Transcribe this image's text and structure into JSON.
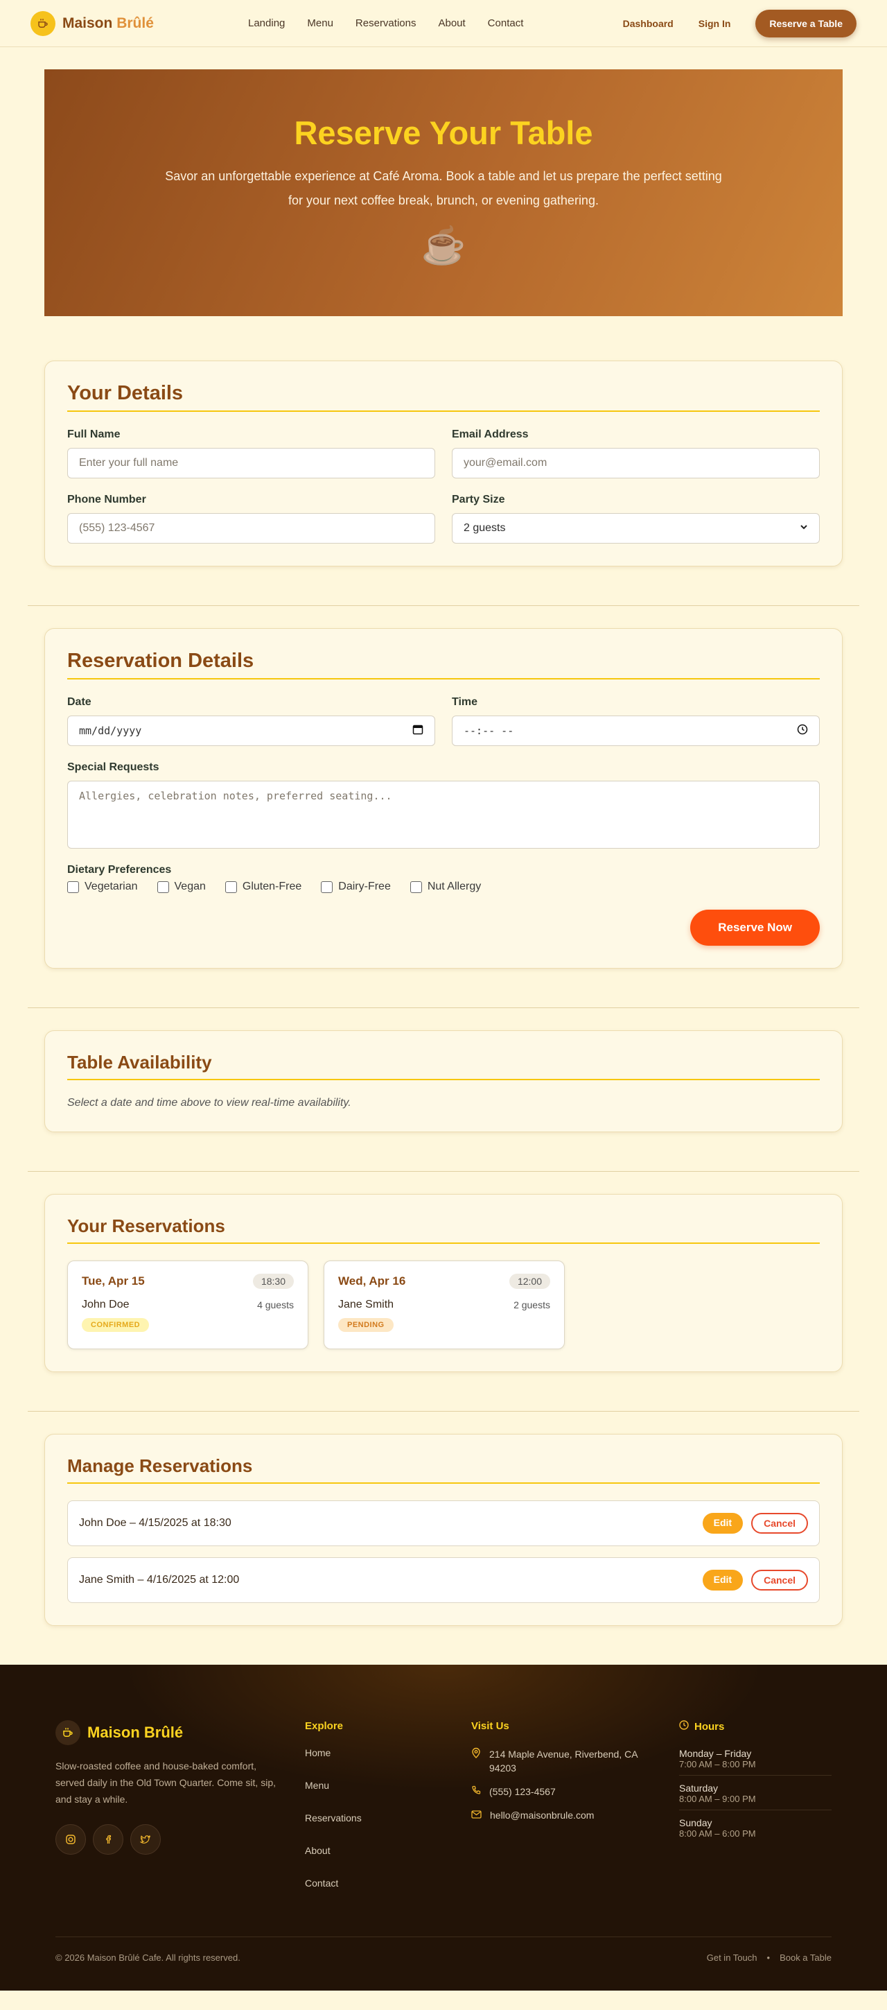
{
  "brand": {
    "name_main": "Maison",
    "name_accent": "Brûlé",
    "footer_name": "Maison Brûlé"
  },
  "nav": {
    "links": [
      "Landing",
      "Menu",
      "Reservations",
      "About",
      "Contact"
    ],
    "dashboard": "Dashboard",
    "signin": "Sign In",
    "reserve": "Reserve a Table"
  },
  "hero": {
    "title": "Reserve Your Table",
    "subtitle": "Savor an unforgettable experience at Café Aroma. Book a table and let us prepare the perfect setting for your next coffee break, brunch, or evening gathering.",
    "icon": "☕"
  },
  "details": {
    "title": "Your Details",
    "full_name_label": "Full Name",
    "full_name_placeholder": "Enter your full name",
    "email_label": "Email Address",
    "email_placeholder": "your@email.com",
    "phone_label": "Phone Number",
    "phone_placeholder": "(555) 123-4567",
    "party_label": "Party Size",
    "party_value": "2 guests"
  },
  "reservation": {
    "title": "Reservation Details",
    "date_label": "Date",
    "date_value": "mm/dd/yyyy",
    "time_label": "Time",
    "time_value": "--:-- --",
    "requests_label": "Special Requests",
    "requests_placeholder": "Allergies, celebration notes, preferred seating...",
    "dietary_label": "Dietary Preferences",
    "dietary": [
      "Vegetarian",
      "Vegan",
      "Gluten-Free",
      "Dairy-Free",
      "Nut Allergy"
    ],
    "submit": "Reserve Now"
  },
  "availability": {
    "title": "Table Availability",
    "hint": "Select a date and time above to view real-time availability."
  },
  "your_reservations": {
    "title": "Your Reservations",
    "items": [
      {
        "date": "Tue, Apr 15",
        "time": "18:30",
        "name": "John Doe",
        "guests": "4 guests",
        "status": "CONFIRMED"
      },
      {
        "date": "Wed, Apr 16",
        "time": "12:00",
        "name": "Jane Smith",
        "guests": "2 guests",
        "status": "PENDING"
      }
    ]
  },
  "manage": {
    "title": "Manage Reservations",
    "rows": [
      "John Doe – 4/15/2025 at 18:30",
      "Jane Smith – 4/16/2025 at 12:00"
    ],
    "edit": "Edit",
    "cancel": "Cancel"
  },
  "footer": {
    "tagline": "Slow-roasted coffee and house-baked comfort, served daily in the Old Town Quarter. Come sit, sip, and stay a while.",
    "explore_title": "Explore",
    "explore": [
      "Home",
      "Menu",
      "Reservations",
      "About",
      "Contact"
    ],
    "visit_title": "Visit Us",
    "address": "214 Maple Avenue, Riverbend, CA 94203",
    "phone": "(555) 123-4567",
    "email": "hello@maisonbrule.com",
    "hours_title": "Hours",
    "hours": [
      {
        "day": "Monday – Friday",
        "time": "7:00 AM – 8:00 PM"
      },
      {
        "day": "Saturday",
        "time": "8:00 AM – 9:00 PM"
      },
      {
        "day": "Sunday",
        "time": "8:00 AM – 6:00 PM"
      }
    ],
    "copyright": "© 2026 Maison Brûlé Cafe. All rights reserved.",
    "bottom_links": [
      "Get in Touch",
      "Book a Table"
    ]
  },
  "colors": {
    "accent": "#fe4e0d",
    "brand_brown": "#8a4a15",
    "gold": "#fcd320"
  }
}
